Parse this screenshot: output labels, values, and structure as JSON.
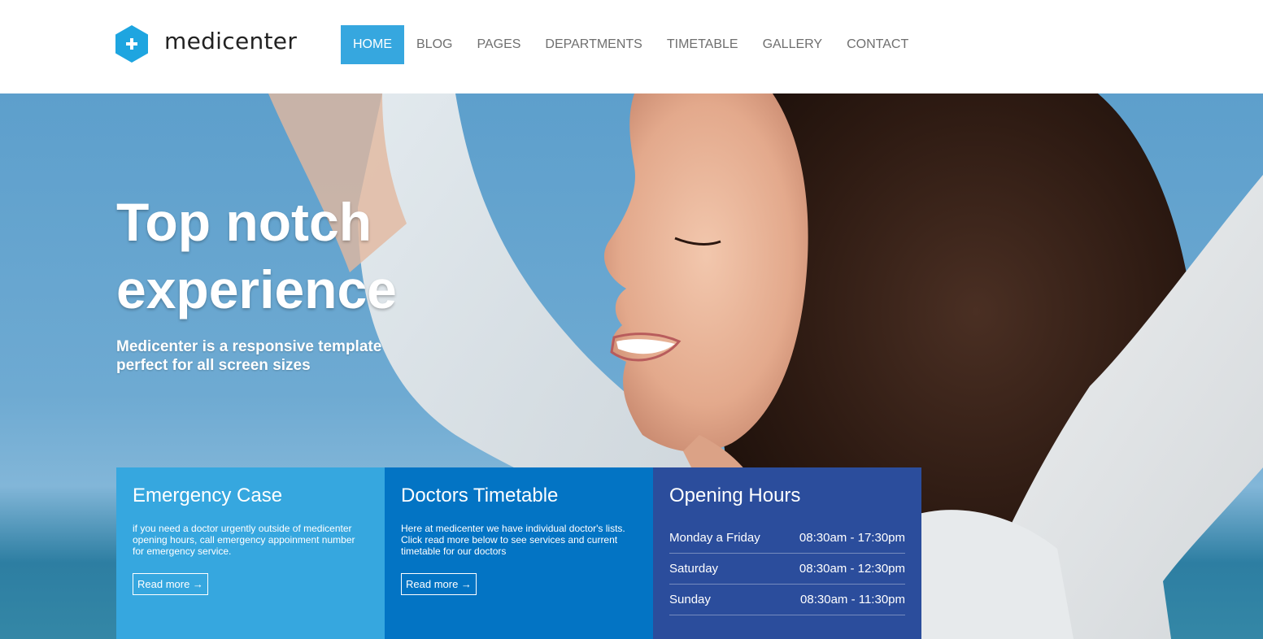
{
  "brand": {
    "name": "medicenter",
    "logo_icon": "plus-hexagon-icon",
    "logo_color": "#1ea5e0"
  },
  "nav": {
    "items": [
      {
        "label": "HOME",
        "active": true
      },
      {
        "label": "BLOG",
        "active": false
      },
      {
        "label": "PAGES",
        "active": false
      },
      {
        "label": "DEPARTMENTS",
        "active": false
      },
      {
        "label": "TIMETABLE",
        "active": false
      },
      {
        "label": "GALLERY",
        "active": false
      },
      {
        "label": "CONTACT",
        "active": false
      }
    ],
    "active_color": "#36a7df"
  },
  "hero": {
    "title_lines": [
      "Top notch",
      "experience"
    ],
    "subtitle_lines": [
      "Medicenter is a responsive template",
      "perfect for all screen sizes"
    ]
  },
  "boxes": {
    "emergency": {
      "title": "Emergency Case",
      "text_lines": [
        "if you need a doctor urgently outside of medicenter",
        "opening hours, call emergency appoinment number",
        "for emergency service."
      ],
      "link": "Read more →",
      "color": "#36a7df"
    },
    "timetable": {
      "title": "Doctors Timetable",
      "text_lines": [
        "Here at medicenter we have individual doctor's lists.",
        "Click read more below to see services and current",
        "timetable for our doctors"
      ],
      "link": "Read more →",
      "color": "#0374c4"
    },
    "hours": {
      "title": "Opening Hours",
      "rows": [
        {
          "day": "Monday a Friday",
          "time": "08:30am - 17:30pm"
        },
        {
          "day": "Saturday",
          "time": "08:30am - 12:30pm"
        },
        {
          "day": "Sunday",
          "time": "08:30am - 11:30pm"
        }
      ],
      "color": "#2b4d9c"
    }
  }
}
